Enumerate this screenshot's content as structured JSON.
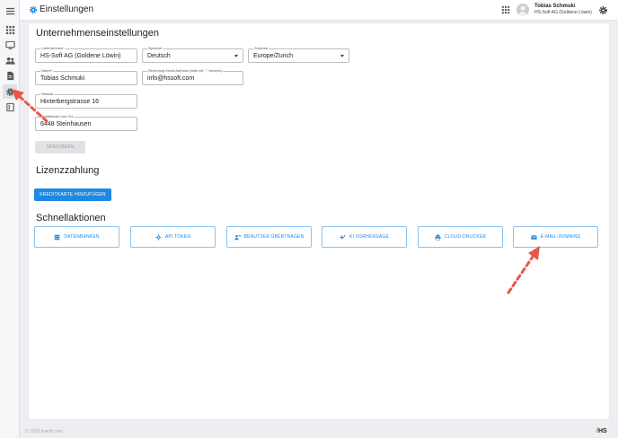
{
  "header": {
    "title": "Einstellungen",
    "user_name": "Tobias Schmuki",
    "user_company": "HS-Soft AG (Goldene Löwin)"
  },
  "sidebar": {
    "items": [
      {
        "icon": "menu-icon"
      },
      {
        "icon": "apps-grid-icon"
      },
      {
        "icon": "monitor-icon"
      },
      {
        "icon": "users-icon"
      },
      {
        "icon": "document-icon"
      },
      {
        "icon": "settings-icon",
        "active": true
      },
      {
        "icon": "book-icon"
      }
    ]
  },
  "company_settings": {
    "heading": "Unternehmenseinstellungen",
    "company": {
      "label": "Unternehmen*",
      "value": "HS-Soft AG (Goldene Löwin)"
    },
    "language": {
      "label": "Sprache",
      "value": "Deutsch"
    },
    "timezone": {
      "label": "Zeitzone",
      "value": "Europe/Zurich"
    },
    "name": {
      "label": "Name*",
      "value": "Tobias Schmuki"
    },
    "invoice_email": {
      "label": "Rechnung Email Adresse (bitte mit \",\" trennen)",
      "value": "info@hssoft.com"
    },
    "street": {
      "label": "Strasse",
      "value": "Hinterbergstrasse 16"
    },
    "zip_city": {
      "label": "Postleitzahl und Ort",
      "value": "6448 Steinhausen"
    },
    "save_label": "SPEICHERN"
  },
  "license": {
    "heading": "Lizenzzahlung",
    "add_card_label": "KREDITKARTE HINZUFÜGEN"
  },
  "quick_actions": {
    "heading": "Schnellaktionen",
    "items": [
      {
        "label": "DATENBANKEN",
        "icon": "database-icon"
      },
      {
        "label": "API TOKEN",
        "icon": "api-icon"
      },
      {
        "label": "BENUTZER ÜBERTRAGEN",
        "icon": "transfer-user-icon"
      },
      {
        "label": "KI VORHERSAGE",
        "icon": "ai-sparkle-icon"
      },
      {
        "label": "CLOUD-DRUCKER",
        "icon": "printer-icon"
      },
      {
        "label": "E-MAIL-DOMAINS",
        "icon": "mail-icon"
      }
    ]
  },
  "footer": {
    "copyright": "© 2025 hssoft.com",
    "brand": "HS"
  },
  "colors": {
    "primary": "#1e88e5",
    "annotation_arrow": "#e8574a"
  }
}
